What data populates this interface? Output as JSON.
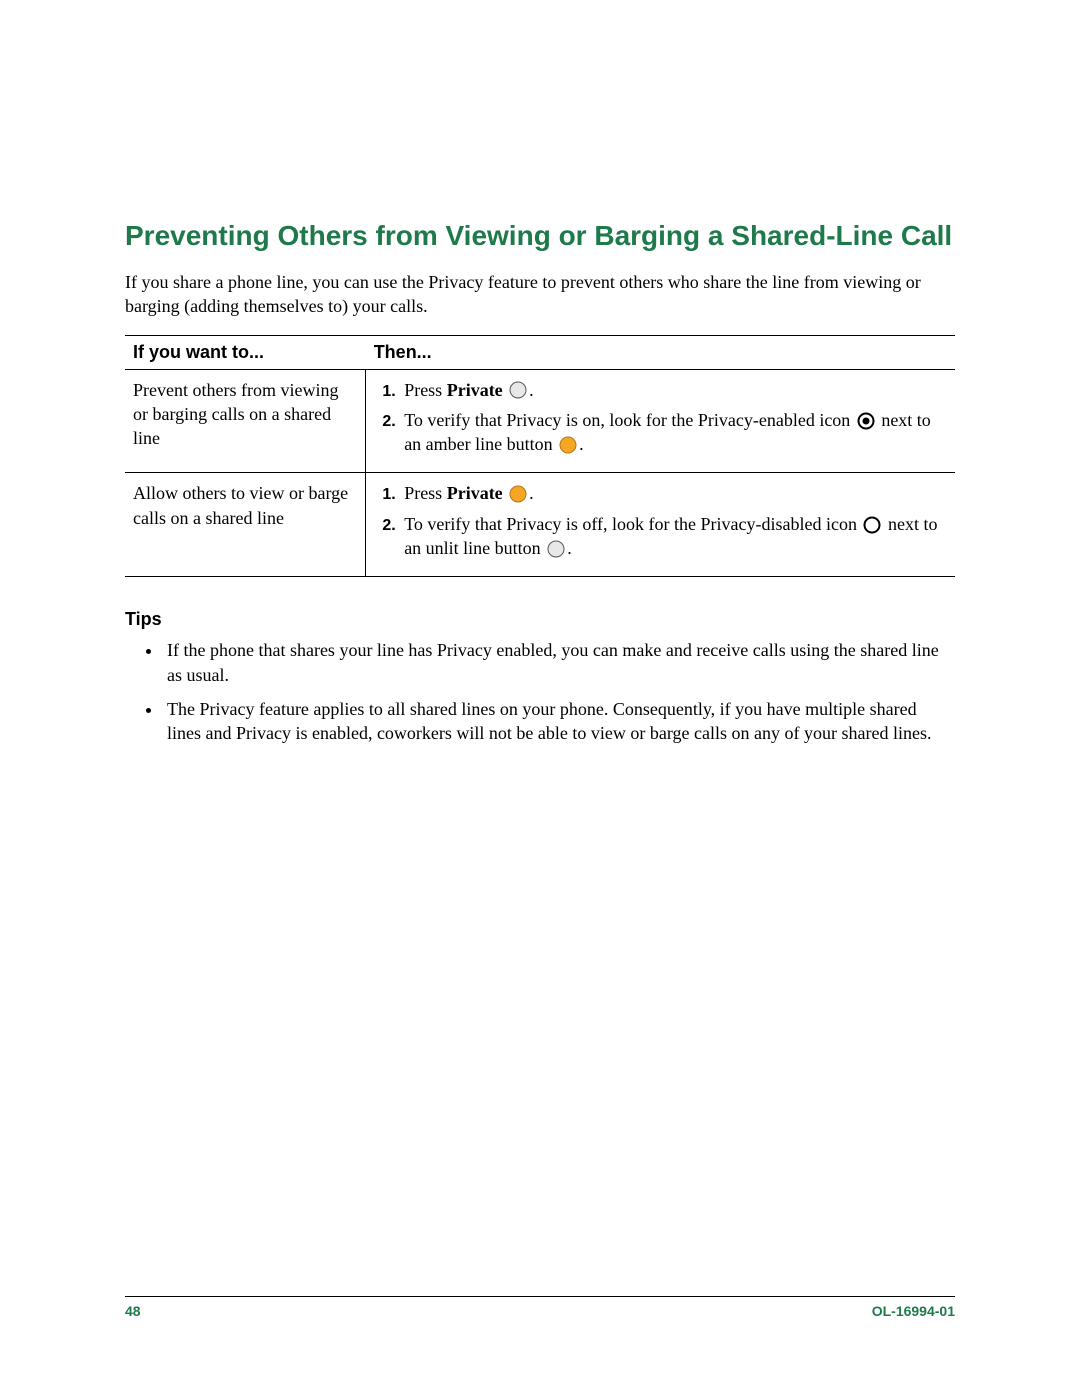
{
  "heading": "Preventing Others from Viewing or Barging a Shared-Line Call",
  "intro": "If you share a phone line, you can use the Privacy feature to prevent others who share the line from viewing or barging (adding themselves to) your calls.",
  "table": {
    "col1_header": "If you want to...",
    "col2_header": "Then...",
    "rows": [
      {
        "want": "Prevent others from viewing or barging calls on a shared line",
        "step1_a": "Press ",
        "step1_b": "Private",
        "step1_c": ".",
        "step2_a": "To verify that Privacy is on, look for the Privacy-enabled icon ",
        "step2_b": " next to an amber line button ",
        "step2_c": "."
      },
      {
        "want": "Allow others to view or barge calls on a shared line",
        "step1_a": "Press ",
        "step1_b": "Private",
        "step1_c": ".",
        "step2_a": "To verify that Privacy is off, look for the Privacy-disabled icon ",
        "step2_b": " next to an unlit line button ",
        "step2_c": "."
      }
    ]
  },
  "tips_heading": "Tips",
  "tips": [
    "If the phone that shares your line has Privacy enabled, you can make and receive calls using the shared line as usual.",
    "The Privacy feature applies to all shared lines on your phone. Consequently, if you have multiple shared lines and Privacy is enabled, coworkers will not be able to view or barge calls on any of your shared lines."
  ],
  "footer": {
    "page": "48",
    "doc": "OL-16994-01"
  }
}
